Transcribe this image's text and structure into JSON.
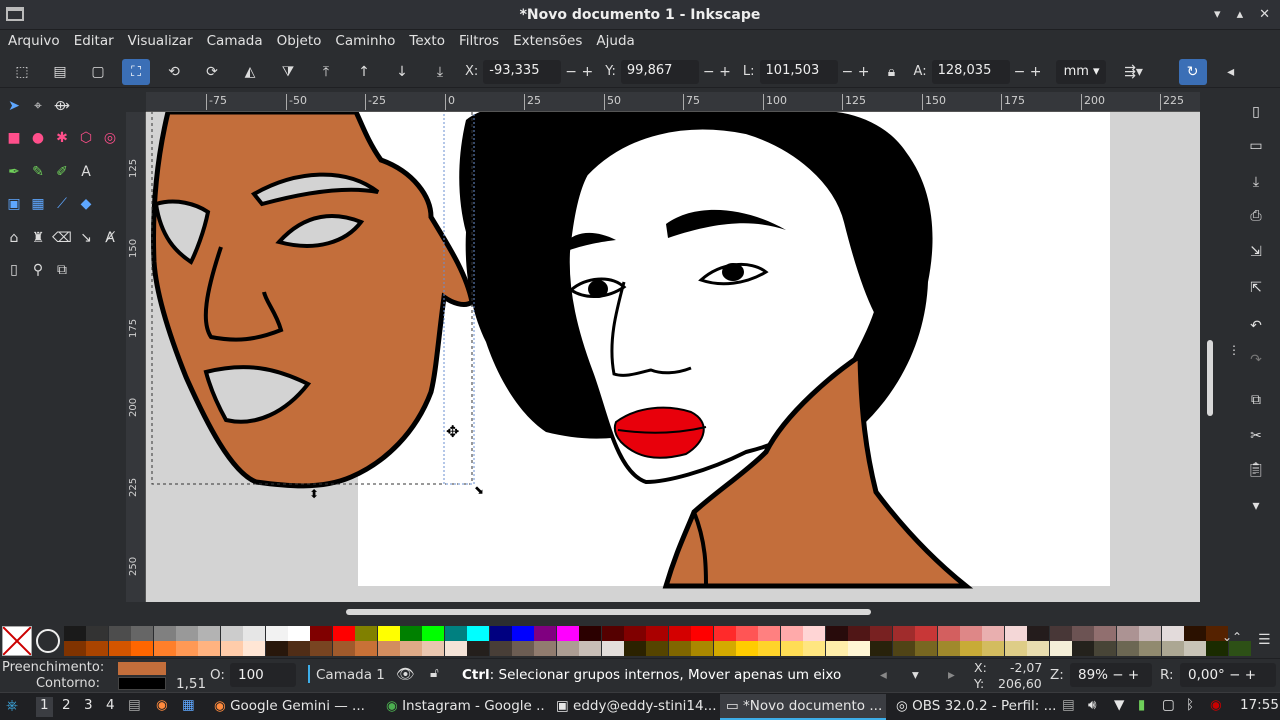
{
  "window": {
    "title": "*Novo documento 1 - Inkscape",
    "minimize": "▾",
    "maximize": "▴",
    "close": "✕"
  },
  "menu": [
    "Arquivo",
    "Editar",
    "Visualizar",
    "Camada",
    "Objeto",
    "Caminho",
    "Texto",
    "Filtros",
    "Extensões",
    "Ajuda"
  ],
  "toolcontrols": {
    "x_label": "X:",
    "x_value": "-93,335",
    "y_label": "Y:",
    "y_value": "99,867",
    "w_label": "L:",
    "w_value": "101,503",
    "h_label": "A:",
    "h_value": "128,035",
    "unit": "mm",
    "minus": "−",
    "plus": "+"
  },
  "ruler": {
    "h_ticks": [
      "-75",
      "-50",
      "-25",
      "0",
      "25",
      "50",
      "75",
      "100",
      "125",
      "150",
      "175",
      "200",
      "225"
    ],
    "v_ticks": [
      "125",
      "150",
      "175",
      "200",
      "225",
      "250"
    ]
  },
  "status": {
    "fill_label": "Preenchimento:",
    "stroke_label": "Contorno:",
    "stroke_width": "1,51",
    "opacity_label": "O:",
    "opacity_value": "100",
    "layer": "Camada 1",
    "message_bold": "Ctrl",
    "message": ": Selecionar grupos internos, Mover apenas um eixo",
    "x_label": "X:",
    "x_value": "-2,07",
    "y_label": "Y:",
    "y_value": "206,60",
    "zoom_label": "Z:",
    "zoom_value": "89%",
    "rotate_label": "R:",
    "rotate_value": "0,00°"
  },
  "taskbar": {
    "desktops": [
      "1",
      "2",
      "3",
      "4"
    ],
    "tasks": [
      "Google Gemini — ...",
      "Instagram - Google ...",
      "eddy@eddy-stini14...",
      "*Novo documento ...",
      "OBS 32.0.2 - Perfil: ..."
    ],
    "clock": "17:55"
  },
  "colors": {
    "skin": "#c36e3b",
    "accent": "#3b6fb6",
    "lips": "#e8000b"
  },
  "palette_row1": [
    "#1a1a1a",
    "#333333",
    "#4d4d4d",
    "#666666",
    "#808080",
    "#999999",
    "#b3b3b3",
    "#cccccc",
    "#e6e6e6",
    "#f2f2f2",
    "#ffffff",
    "#800000",
    "#ff0000",
    "#808000",
    "#ffff00",
    "#008000",
    "#00ff00",
    "#008080",
    "#00ffff",
    "#000080",
    "#0000ff",
    "#800080",
    "#ff00ff",
    "#2b0000",
    "#550000",
    "#800000",
    "#aa0000",
    "#d40000",
    "#ff0000",
    "#ff2a2a",
    "#ff5555",
    "#ff8080",
    "#ffaaaa",
    "#ffd5d5",
    "#280b0b",
    "#501616",
    "#782121",
    "#a02c2c",
    "#c83737",
    "#d35f5f",
    "#de8787",
    "#e9afaf",
    "#f4d7d7",
    "#241c1c",
    "#483737",
    "#6c5353",
    "#916f6f",
    "#ac9393",
    "#c8b7b7",
    "#e3dbdb",
    "#2b1100",
    "#552200"
  ],
  "palette_row2": [
    "#803300",
    "#aa4400",
    "#d45500",
    "#ff6600",
    "#ff7f2a",
    "#ff9955",
    "#ffb380",
    "#ffccaa",
    "#ffe6d5",
    "#28170b",
    "#502d16",
    "#784421",
    "#a05a2c",
    "#c87137",
    "#d38d5f",
    "#deaa87",
    "#e9c6af",
    "#f4e3d7",
    "#241f1c",
    "#483e37",
    "#6c5d53",
    "#917c6f",
    "#ac9d93",
    "#c8beb7",
    "#e3dedb",
    "#2b2200",
    "#554400",
    "#806600",
    "#aa8800",
    "#d4aa00",
    "#ffcc00",
    "#ffd42a",
    "#ffdd55",
    "#ffe680",
    "#ffeeaa",
    "#fff6d5",
    "#28220b",
    "#504416",
    "#786721",
    "#a0892c",
    "#c8ab37",
    "#d3bc5f",
    "#decd87",
    "#e9ddaf",
    "#f4eed7",
    "#24221c",
    "#484537",
    "#6c6753",
    "#918a6f",
    "#aca793",
    "#c8c4b7",
    "#1a2b00",
    "#2d5016"
  ]
}
